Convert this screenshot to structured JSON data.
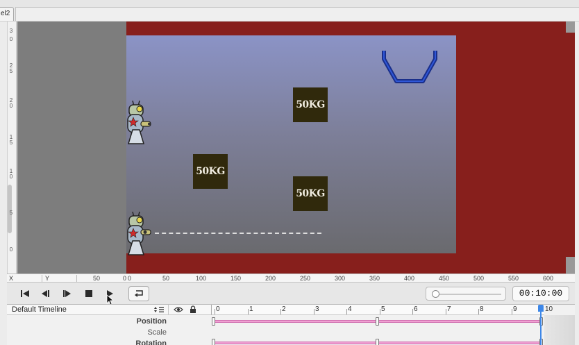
{
  "window": {
    "tab_label": "el2"
  },
  "ruler_vertical": {
    "labels": [
      "3",
      "0",
      "2",
      "5",
      "2",
      "0",
      "1",
      "5",
      "1",
      "0",
      "5",
      "0"
    ]
  },
  "ruler_horizontal": {
    "x_label": "X",
    "y_label": "Y",
    "left_labels": [
      "50",
      "0"
    ],
    "labels": [
      "0",
      "50",
      "100",
      "150",
      "200",
      "250",
      "300",
      "350",
      "400",
      "450",
      "500",
      "550",
      "600"
    ]
  },
  "scene": {
    "crates": [
      {
        "label": "50KG"
      },
      {
        "label": "50KG"
      },
      {
        "label": "50KG"
      }
    ],
    "colors": {
      "backdrop": "#871f1c",
      "sky_top": "#8b93c6",
      "sky_bottom": "#6a6a6e",
      "crate": "#30290c",
      "basket": "#1a2f8a"
    }
  },
  "controls": {
    "buttons": [
      "skip-to-start-icon",
      "step-back-icon",
      "step-forward-icon",
      "stop-icon",
      "play-icon",
      "loop-icon"
    ],
    "timecode": "00:10:00"
  },
  "timeline": {
    "name": "Default Timeline",
    "ruler": [
      "0",
      "1",
      "2",
      "3",
      "4",
      "5",
      "6",
      "7",
      "8",
      "9",
      "10"
    ],
    "rows": [
      {
        "label": "Position"
      },
      {
        "label": "Scale"
      },
      {
        "label": "Rotation"
      }
    ],
    "colors": {
      "track": "#f0a0d2",
      "playhead": "#3d87e8"
    }
  }
}
